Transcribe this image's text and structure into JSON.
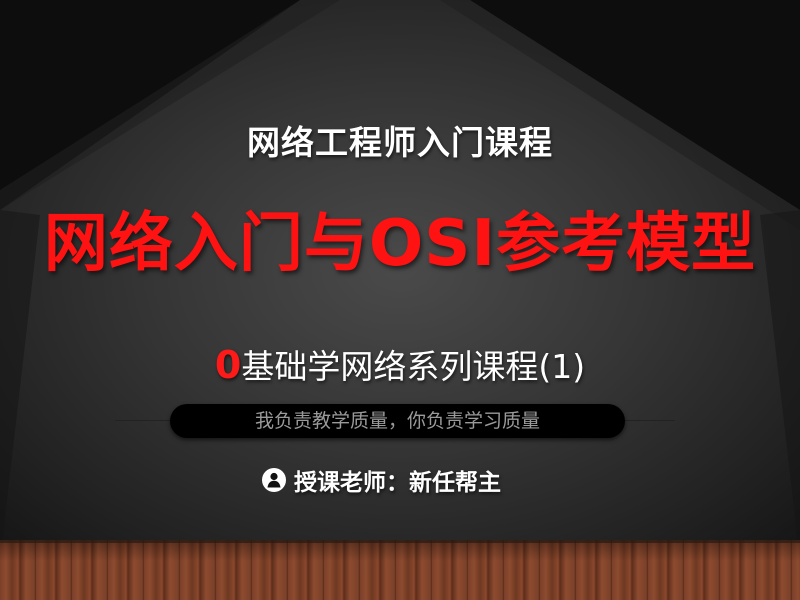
{
  "slide": {
    "subtitle": "网络工程师入门课程",
    "title": "网络入门与OSI参考模型",
    "series_number": "0",
    "series_text": "基础学网络系列课程(1)",
    "slogan": "我负责教学质量，你负责学习质量",
    "teacher": "授课老师：新任帮主"
  },
  "icons": {
    "teacher": "person-icon"
  },
  "colors": {
    "title_red": "#ff1212",
    "background": "#3a3a3a",
    "floor": "#7a3f28"
  }
}
